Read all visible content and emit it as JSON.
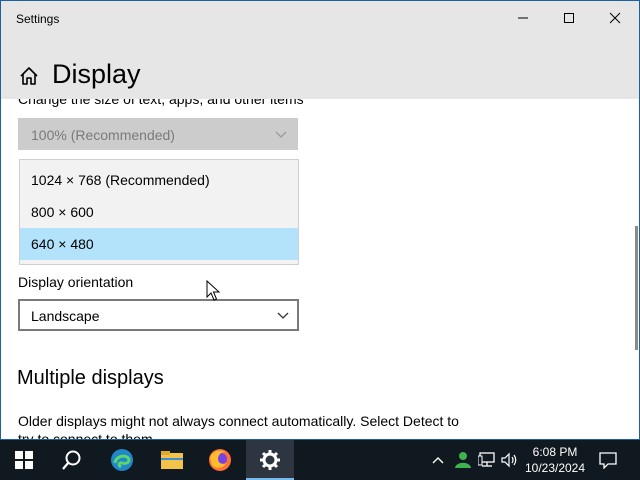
{
  "window": {
    "app_title": "Settings",
    "minimize_icon": "minimize-icon",
    "maximize_icon": "maximize-icon",
    "close_icon": "close-icon"
  },
  "header": {
    "home_icon": "home-icon",
    "title": "Display"
  },
  "scale": {
    "label": "Change the size of text, apps, and other items",
    "value": "100% (Recommended)",
    "disabled": true
  },
  "resolution": {
    "options": [
      "1024 × 768 (Recommended)",
      "800 × 600",
      "640 × 480"
    ],
    "highlighted": "640 × 480"
  },
  "orientation": {
    "label": "Display orientation",
    "value": "Landscape"
  },
  "multiple_displays": {
    "title": "Multiple displays",
    "description": "Older displays might not always connect automatically. Select Detect to try to connect to them."
  },
  "taskbar": {
    "items": [
      "start-icon",
      "search-icon",
      "edge-icon",
      "file-explorer-icon",
      "firefox-icon",
      "settings-gear-icon"
    ],
    "active": "settings-gear-icon",
    "tray_icons": [
      "chevron-up-icon",
      "user-network-icon",
      "network-icon",
      "volume-icon",
      "notification-icon"
    ],
    "time": "6:08 PM",
    "date": "10/23/2024"
  },
  "colors": {
    "highlight": "#b3e3fb",
    "taskbar": "#101820",
    "titlebar": "#e6e6e6",
    "accent_border": "#1f5f9a"
  }
}
